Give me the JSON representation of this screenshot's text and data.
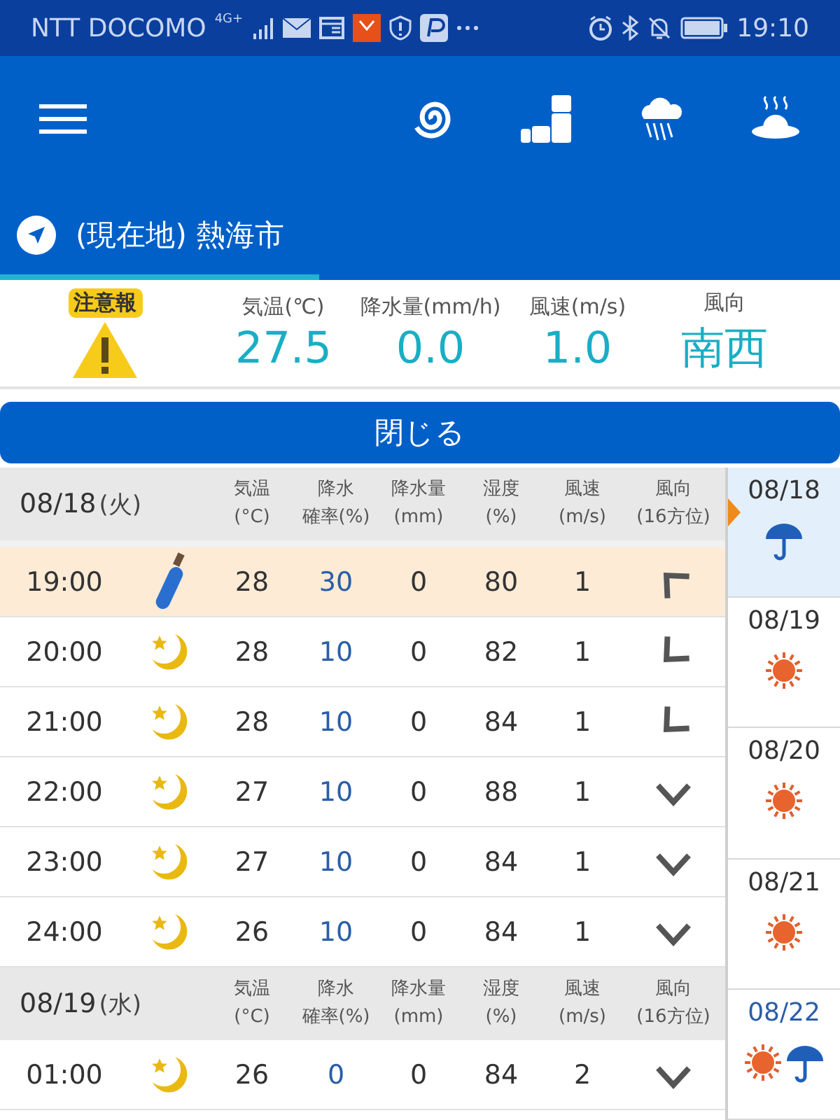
{
  "status_bar": {
    "carrier": "NTT DOCOMO",
    "network": "4G+",
    "time": "19:10"
  },
  "tabs": [
    {
      "label": "(現在地) 熱海市",
      "selected": true
    }
  ],
  "current": {
    "alert": "注意報",
    "items": [
      {
        "label": "気温(℃)",
        "value": "27.5"
      },
      {
        "label": "降水量(mm/h)",
        "value": "0.0"
      },
      {
        "label": "風速(m/s)",
        "value": "1.0"
      },
      {
        "label": "風向",
        "value": "南西"
      }
    ]
  },
  "close_button": "閉じる",
  "days": [
    {
      "date": "08/18",
      "weekday": "(火)",
      "columns": [
        {
          "lines": [
            "気温",
            "(°C)"
          ]
        },
        {
          "lines": [
            "降水",
            "確率(%)"
          ]
        },
        {
          "lines": [
            "降水量",
            "(mm)"
          ]
        },
        {
          "lines": [
            "湿度",
            "(%)"
          ]
        },
        {
          "lines": [
            "風速",
            "(m/s)"
          ]
        },
        {
          "lines": [
            "風向",
            "(16方位)"
          ]
        }
      ],
      "rows": [
        {
          "time": "19:00",
          "weather": {
            "kind": "umbrella"
          },
          "temp": "28",
          "prob": "30",
          "amount": "0",
          "humidity": "80",
          "wind": "1",
          "wind_arrow": {
            "kind": "nw"
          },
          "selected": true
        },
        {
          "time": "20:00",
          "weather": {
            "kind": "moon"
          },
          "temp": "28",
          "prob": "10",
          "amount": "0",
          "humidity": "82",
          "wind": "1",
          "wind_arrow": {
            "kind": "sw"
          },
          "selected": false
        },
        {
          "time": "21:00",
          "weather": {
            "kind": "moon"
          },
          "temp": "28",
          "prob": "10",
          "amount": "0",
          "humidity": "84",
          "wind": "1",
          "wind_arrow": {
            "kind": "sw"
          },
          "selected": false
        },
        {
          "time": "22:00",
          "weather": {
            "kind": "moon"
          },
          "temp": "27",
          "prob": "10",
          "amount": "0",
          "humidity": "88",
          "wind": "1",
          "wind_arrow": {
            "kind": "s"
          },
          "selected": false
        },
        {
          "time": "23:00",
          "weather": {
            "kind": "moon"
          },
          "temp": "27",
          "prob": "10",
          "amount": "0",
          "humidity": "84",
          "wind": "1",
          "wind_arrow": {
            "kind": "s"
          },
          "selected": false
        },
        {
          "time": "24:00",
          "weather": {
            "kind": "moon"
          },
          "temp": "26",
          "prob": "10",
          "amount": "0",
          "humidity": "84",
          "wind": "1",
          "wind_arrow": {
            "kind": "s"
          },
          "selected": false
        }
      ]
    },
    {
      "date": "08/19",
      "weekday": "(水)",
      "columns": [
        {
          "lines": [
            "気温",
            "(°C)"
          ]
        },
        {
          "lines": [
            "降水",
            "確率(%)"
          ]
        },
        {
          "lines": [
            "降水量",
            "(mm)"
          ]
        },
        {
          "lines": [
            "湿度",
            "(%)"
          ]
        },
        {
          "lines": [
            "風速",
            "(m/s)"
          ]
        },
        {
          "lines": [
            "風向",
            "(16方位)"
          ]
        }
      ],
      "rows": [
        {
          "time": "01:00",
          "weather": {
            "kind": "moon"
          },
          "temp": "26",
          "prob": "0",
          "amount": "0",
          "humidity": "84",
          "wind": "2",
          "wind_arrow": {
            "kind": "s"
          },
          "selected": false
        }
      ]
    }
  ],
  "week": [
    {
      "date": "08/18",
      "weather": {
        "kind": "rain"
      },
      "selected": true,
      "saturday": false
    },
    {
      "date": "08/19",
      "weather": {
        "kind": "sun"
      },
      "selected": false,
      "saturday": false
    },
    {
      "date": "08/20",
      "weather": {
        "kind": "sun"
      },
      "selected": false,
      "saturday": false
    },
    {
      "date": "08/21",
      "weather": {
        "kind": "sun"
      },
      "selected": false,
      "saturday": false
    },
    {
      "date": "08/22",
      "weather": {
        "kind": "sun_rain"
      },
      "selected": false,
      "saturday": true
    }
  ]
}
